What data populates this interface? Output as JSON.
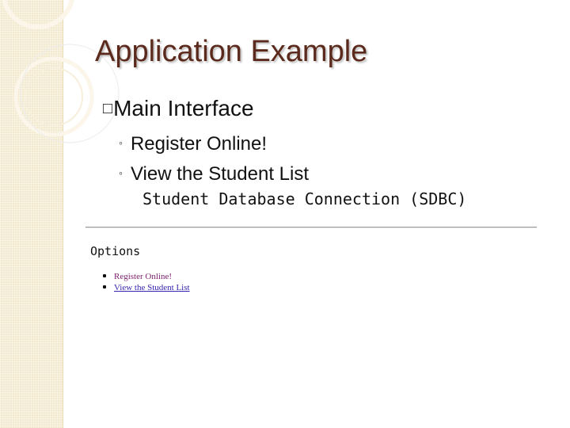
{
  "slide": {
    "title": "Application Example",
    "bullet_marker": "□",
    "main_bullet": "Main Interface",
    "sub_bullet_marker": "◦",
    "sub_bullets": [
      "Register Online!",
      "View the Student List"
    ]
  },
  "screenshot": {
    "page_title": "Student Database Connection (SDBC)",
    "section_heading": "Options",
    "links": [
      {
        "label": "Register Online!"
      },
      {
        "label": "View the Student List"
      }
    ]
  },
  "colors": {
    "title": "#5b2a1c",
    "band": "#f3e9cf",
    "link": "#3526b0"
  }
}
